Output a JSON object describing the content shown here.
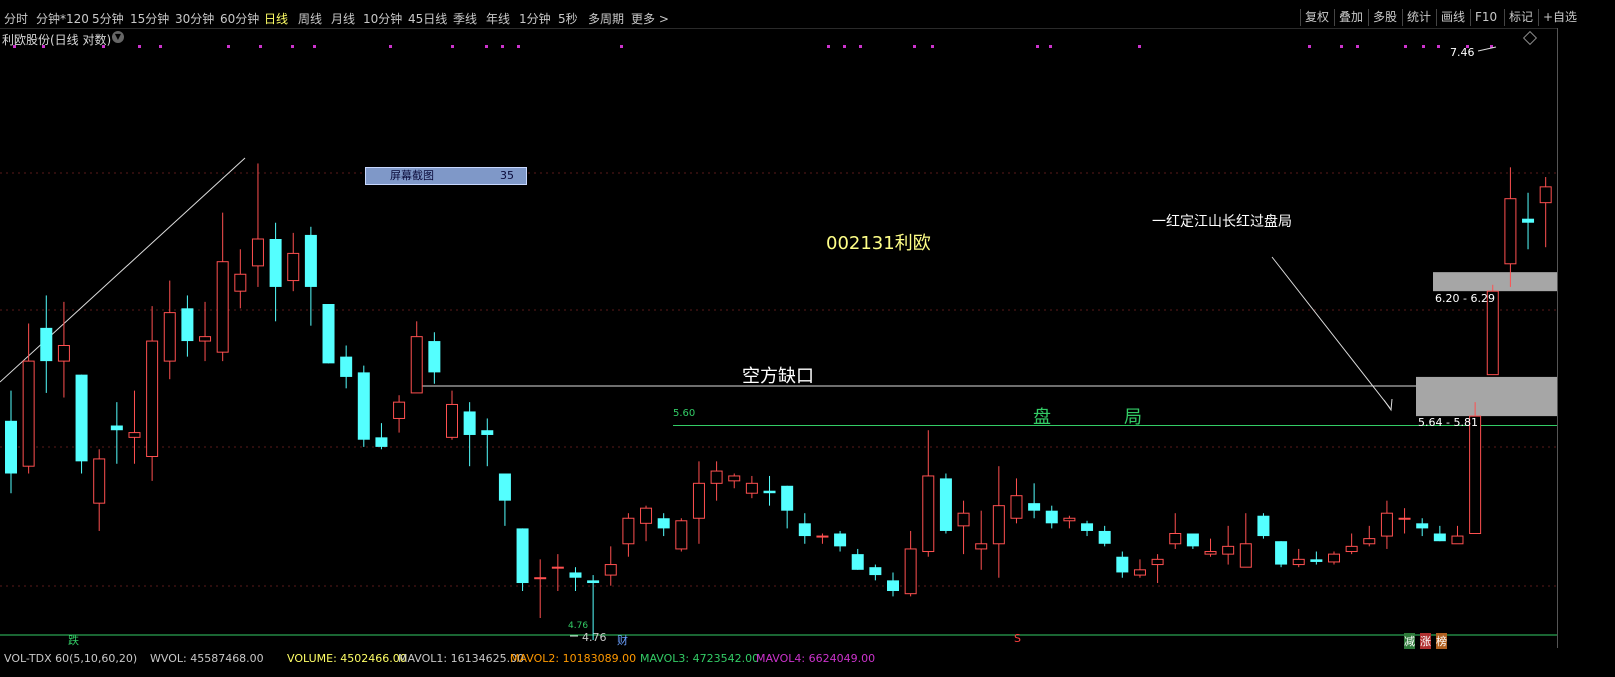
{
  "toolbar": {
    "periods": [
      "分时",
      "分钟*120",
      "5分钟",
      "15分钟",
      "30分钟",
      "60分钟",
      "日线",
      "周线",
      "月线",
      "10分钟",
      "45日线",
      "季线",
      "年线",
      "1分钟",
      "5秒",
      "多周期",
      "更多 >"
    ],
    "active_period": "日线",
    "right_buttons": [
      "复权",
      "叠加",
      "多股",
      "统计",
      "画线",
      "F10",
      "标记",
      "+自选"
    ]
  },
  "stock_title": "利欧股份(日线 对数)",
  "title_caret_icon": "chevron-down-icon",
  "overlay": {
    "screenshot_label": "屏幕截图",
    "screenshot_count": "35"
  },
  "annotations": {
    "stock_code_title": "002131利欧",
    "gap_label": "空方缺口",
    "consolidation_left": "盘",
    "consolidation_right": "局",
    "consolidation_price": "5.60",
    "note_text": "一红定江山长红过盘局",
    "gap_zone_upper": "6.20 - 6.29",
    "gap_zone_lower": "5.64 - 5.81",
    "high_price": "7.46",
    "low_price": "4.76",
    "low_price_small": "4.76"
  },
  "markers": {
    "m1": "跌",
    "m2": "财",
    "m3": "S",
    "m4": "减",
    "m5": "涨",
    "m6": "榜"
  },
  "footer": {
    "vol_label": "VOL-TDX 60(5,10,60,20)",
    "wvol": "WVOL: 45587468.00",
    "volume": "VOLUME: 4502466.00",
    "mavol1": "MAVOL1: 16134625.00",
    "mavol2": "MAVOL2: 10183089.00",
    "mavol3": "MAVOL3: 4723542.00",
    "mavol4": "MAVOL4: 6624049.00"
  },
  "colors": {
    "up": "#ff5050",
    "down": "#54ffff",
    "active": "#ffff66",
    "green_line": "#33cc66",
    "purple_dot": "#cc33cc",
    "gap_box": "#a6a6a6"
  },
  "chart_data": {
    "type": "candlestick",
    "scale": "log",
    "consolidation_level": 5.6,
    "gap_zones": [
      [
        6.2,
        6.29
      ],
      [
        5.64,
        5.81
      ]
    ],
    "high": 7.46,
    "low": 4.76,
    "candles": [
      {
        "o": 5.62,
        "c": 5.4,
        "h": 5.75,
        "l": 5.32
      },
      {
        "o": 5.43,
        "c": 5.88,
        "h": 6.05,
        "l": 5.4
      },
      {
        "o": 6.03,
        "c": 5.88,
        "h": 6.18,
        "l": 5.74
      },
      {
        "o": 5.88,
        "c": 5.95,
        "h": 6.15,
        "l": 5.72
      },
      {
        "o": 5.82,
        "c": 5.45,
        "h": 5.82,
        "l": 5.4
      },
      {
        "o": 5.28,
        "c": 5.46,
        "h": 5.5,
        "l": 5.17
      },
      {
        "o": 5.6,
        "c": 5.58,
        "h": 5.7,
        "l": 5.44
      },
      {
        "o": 5.55,
        "c": 5.57,
        "h": 5.75,
        "l": 5.44
      },
      {
        "o": 5.47,
        "c": 5.97,
        "h": 6.13,
        "l": 5.37
      },
      {
        "o": 5.88,
        "c": 6.1,
        "h": 6.25,
        "l": 5.8
      },
      {
        "o": 6.12,
        "c": 5.97,
        "h": 6.18,
        "l": 5.9
      },
      {
        "o": 5.97,
        "c": 5.99,
        "h": 6.15,
        "l": 5.88
      },
      {
        "o": 5.92,
        "c": 6.34,
        "h": 6.58,
        "l": 5.88
      },
      {
        "o": 6.2,
        "c": 6.28,
        "h": 6.4,
        "l": 6.12
      },
      {
        "o": 6.32,
        "c": 6.45,
        "h": 6.83,
        "l": 6.22
      },
      {
        "o": 6.45,
        "c": 6.22,
        "h": 6.53,
        "l": 6.06
      },
      {
        "o": 6.25,
        "c": 6.38,
        "h": 6.48,
        "l": 6.2
      },
      {
        "o": 6.47,
        "c": 6.22,
        "h": 6.51,
        "l": 6.04
      },
      {
        "o": 6.14,
        "c": 5.87,
        "h": 6.14,
        "l": 5.87
      },
      {
        "o": 5.9,
        "c": 5.81,
        "h": 5.95,
        "l": 5.76
      },
      {
        "o": 5.83,
        "c": 5.54,
        "h": 5.86,
        "l": 5.51
      },
      {
        "o": 5.55,
        "c": 5.51,
        "h": 5.61,
        "l": 5.5
      },
      {
        "o": 5.63,
        "c": 5.7,
        "h": 5.73,
        "l": 5.57
      },
      {
        "o": 5.74,
        "c": 5.99,
        "h": 6.06,
        "l": 5.74
      },
      {
        "o": 5.97,
        "c": 5.83,
        "h": 6.01,
        "l": 5.78
      },
      {
        "o": 5.55,
        "c": 5.69,
        "h": 5.75,
        "l": 5.54
      },
      {
        "o": 5.66,
        "c": 5.56,
        "h": 5.7,
        "l": 5.43
      },
      {
        "o": 5.58,
        "c": 5.56,
        "h": 5.63,
        "l": 5.43
      },
      {
        "o": 5.4,
        "c": 5.29,
        "h": 5.4,
        "l": 5.19
      },
      {
        "o": 5.18,
        "c": 4.97,
        "h": 5.18,
        "l": 4.94
      },
      {
        "o": 4.99,
        "c": 4.99,
        "h": 5.06,
        "l": 4.84
      },
      {
        "o": 5.03,
        "c": 5.03,
        "h": 5.08,
        "l": 4.94
      },
      {
        "o": 5.01,
        "c": 4.99,
        "h": 5.03,
        "l": 4.94
      },
      {
        "o": 4.98,
        "c": 4.97,
        "h": 5.0,
        "l": 4.76
      },
      {
        "o": 5.0,
        "c": 5.04,
        "h": 5.11,
        "l": 4.96
      },
      {
        "o": 5.12,
        "c": 5.22,
        "h": 5.24,
        "l": 5.07
      },
      {
        "o": 5.2,
        "c": 5.26,
        "h": 5.27,
        "l": 5.13
      },
      {
        "o": 5.22,
        "c": 5.18,
        "h": 5.24,
        "l": 5.15
      },
      {
        "o": 5.1,
        "c": 5.21,
        "h": 5.22,
        "l": 5.09
      },
      {
        "o": 5.22,
        "c": 5.36,
        "h": 5.45,
        "l": 5.12
      },
      {
        "o": 5.36,
        "c": 5.41,
        "h": 5.45,
        "l": 5.29
      },
      {
        "o": 5.37,
        "c": 5.39,
        "h": 5.4,
        "l": 5.34
      },
      {
        "o": 5.32,
        "c": 5.36,
        "h": 5.39,
        "l": 5.3
      },
      {
        "o": 5.33,
        "c": 5.32,
        "h": 5.39,
        "l": 5.27
      },
      {
        "o": 5.35,
        "c": 5.25,
        "h": 5.35,
        "l": 5.18
      },
      {
        "o": 5.2,
        "c": 5.15,
        "h": 5.24,
        "l": 5.12
      },
      {
        "o": 5.15,
        "c": 5.15,
        "h": 5.16,
        "l": 5.12
      },
      {
        "o": 5.16,
        "c": 5.11,
        "h": 5.17,
        "l": 5.09
      },
      {
        "o": 5.08,
        "c": 5.02,
        "h": 5.1,
        "l": 5.02
      },
      {
        "o": 5.03,
        "c": 5.0,
        "h": 5.04,
        "l": 4.98
      },
      {
        "o": 4.98,
        "c": 4.94,
        "h": 5.01,
        "l": 4.92
      },
      {
        "o": 4.93,
        "c": 5.1,
        "h": 5.17,
        "l": 4.92
      },
      {
        "o": 5.09,
        "c": 5.39,
        "h": 5.58,
        "l": 5.07
      },
      {
        "o": 5.38,
        "c": 5.17,
        "h": 5.4,
        "l": 5.16
      },
      {
        "o": 5.19,
        "c": 5.24,
        "h": 5.29,
        "l": 5.08
      },
      {
        "o": 5.1,
        "c": 5.12,
        "h": 5.25,
        "l": 5.02
      },
      {
        "o": 5.12,
        "c": 5.27,
        "h": 5.43,
        "l": 4.99
      },
      {
        "o": 5.22,
        "c": 5.31,
        "h": 5.38,
        "l": 5.2
      },
      {
        "o": 5.28,
        "c": 5.25,
        "h": 5.36,
        "l": 5.22
      },
      {
        "o": 5.25,
        "c": 5.2,
        "h": 5.27,
        "l": 5.18
      },
      {
        "o": 5.21,
        "c": 5.22,
        "h": 5.23,
        "l": 5.18
      },
      {
        "o": 5.2,
        "c": 5.17,
        "h": 5.21,
        "l": 5.15
      },
      {
        "o": 5.17,
        "c": 5.12,
        "h": 5.19,
        "l": 5.11
      },
      {
        "o": 5.07,
        "c": 5.01,
        "h": 5.09,
        "l": 4.99
      },
      {
        "o": 5.0,
        "c": 5.02,
        "h": 5.06,
        "l": 4.99
      },
      {
        "o": 5.04,
        "c": 5.06,
        "h": 5.08,
        "l": 4.97
      },
      {
        "o": 5.12,
        "c": 5.16,
        "h": 5.24,
        "l": 5.1
      },
      {
        "o": 5.16,
        "c": 5.11,
        "h": 5.16,
        "l": 5.1
      },
      {
        "o": 5.08,
        "c": 5.09,
        "h": 5.14,
        "l": 5.07
      },
      {
        "o": 5.08,
        "c": 5.11,
        "h": 5.19,
        "l": 5.04
      },
      {
        "o": 5.03,
        "c": 5.12,
        "h": 5.24,
        "l": 5.03
      },
      {
        "o": 5.23,
        "c": 5.15,
        "h": 5.24,
        "l": 5.14
      },
      {
        "o": 5.13,
        "c": 5.04,
        "h": 5.13,
        "l": 5.03
      },
      {
        "o": 5.04,
        "c": 5.06,
        "h": 5.1,
        "l": 5.03
      },
      {
        "o": 5.06,
        "c": 5.05,
        "h": 5.09,
        "l": 5.04
      },
      {
        "o": 5.05,
        "c": 5.08,
        "h": 5.09,
        "l": 5.04
      },
      {
        "o": 5.09,
        "c": 5.11,
        "h": 5.16,
        "l": 5.08
      },
      {
        "o": 5.12,
        "c": 5.14,
        "h": 5.19,
        "l": 5.11
      },
      {
        "o": 5.15,
        "c": 5.24,
        "h": 5.29,
        "l": 5.1
      },
      {
        "o": 5.22,
        "c": 5.22,
        "h": 5.26,
        "l": 5.16
      },
      {
        "o": 5.2,
        "c": 5.18,
        "h": 5.22,
        "l": 5.15
      },
      {
        "o": 5.16,
        "c": 5.13,
        "h": 5.19,
        "l": 5.13
      },
      {
        "o": 5.12,
        "c": 5.15,
        "h": 5.19,
        "l": 5.12
      },
      {
        "o": 5.16,
        "c": 5.64,
        "h": 5.7,
        "l": 5.16
      },
      {
        "o": 5.82,
        "c": 6.2,
        "h": 6.23,
        "l": 5.82
      },
      {
        "o": 6.33,
        "c": 6.65,
        "h": 6.81,
        "l": 6.22
      },
      {
        "o": 6.55,
        "c": 6.53,
        "h": 6.68,
        "l": 6.4
      },
      {
        "o": 6.63,
        "c": 6.71,
        "h": 6.76,
        "l": 6.41
      },
      {
        "o": 6.73,
        "c": 7.44,
        "h": 7.47,
        "l": 6.73
      }
    ]
  }
}
